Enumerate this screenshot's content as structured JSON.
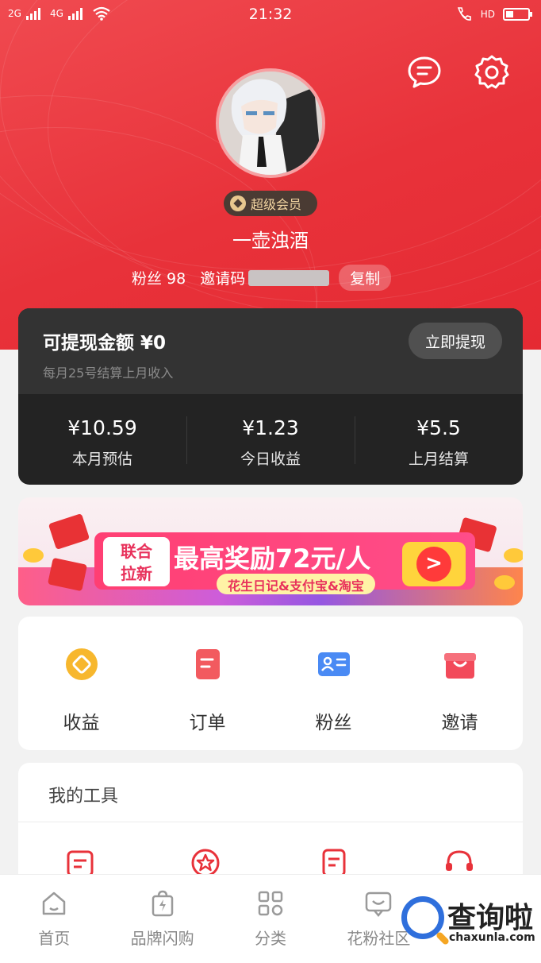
{
  "status_bar": {
    "network_1": "2G",
    "network_2": "4G",
    "time": "21:32",
    "hd": "HD",
    "battery_level": 0.35
  },
  "header_icons": {
    "message": "message-icon",
    "settings": "gear-icon"
  },
  "profile": {
    "vip_badge": "超级会员",
    "username": "一壶浊酒",
    "fans_label": "粉丝 98",
    "invite_label": "邀请码",
    "copy_button": "复制"
  },
  "wallet": {
    "title": "可提现金额 ¥0",
    "subtitle": "每月25号结算上月收入",
    "withdraw_button": "立即提现",
    "stats": [
      {
        "value": "¥10.59",
        "label": "本月预估"
      },
      {
        "value": "¥1.23",
        "label": "今日收益"
      },
      {
        "value": "¥5.5",
        "label": "上月结算"
      }
    ]
  },
  "banner": {
    "tag_line1": "联合",
    "tag_line2": "拉新",
    "headline": "最高奖励72元/人",
    "subline": "花生日记&支付宝&淘宝",
    "go": ">"
  },
  "quick_actions": [
    {
      "label": "收益",
      "icon": "earnings-icon",
      "color": "#f7b72d"
    },
    {
      "label": "订单",
      "icon": "order-icon",
      "color": "#f25a5f"
    },
    {
      "label": "粉丝",
      "icon": "fans-icon",
      "color": "#4a8af4"
    },
    {
      "label": "邀请",
      "icon": "invite-gift-icon",
      "color": "#f24a5a"
    }
  ],
  "tools": {
    "title": "我的工具",
    "icons": [
      "tool-doc-icon",
      "tool-star-icon",
      "tool-note-icon",
      "tool-headset-icon"
    ]
  },
  "tab_bar": [
    {
      "label": "首页",
      "icon": "home-icon"
    },
    {
      "label": "品牌闪购",
      "icon": "flash-bag-icon"
    },
    {
      "label": "分类",
      "icon": "category-grid-icon"
    },
    {
      "label": "花粉社区",
      "icon": "community-icon"
    }
  ],
  "watermark": {
    "title": "查询啦",
    "domain": "chaxunla.com"
  },
  "colors": {
    "primary_red": "#e8323a",
    "wallet_dark": "#232323",
    "vip_gold": "#f3d6a2"
  }
}
